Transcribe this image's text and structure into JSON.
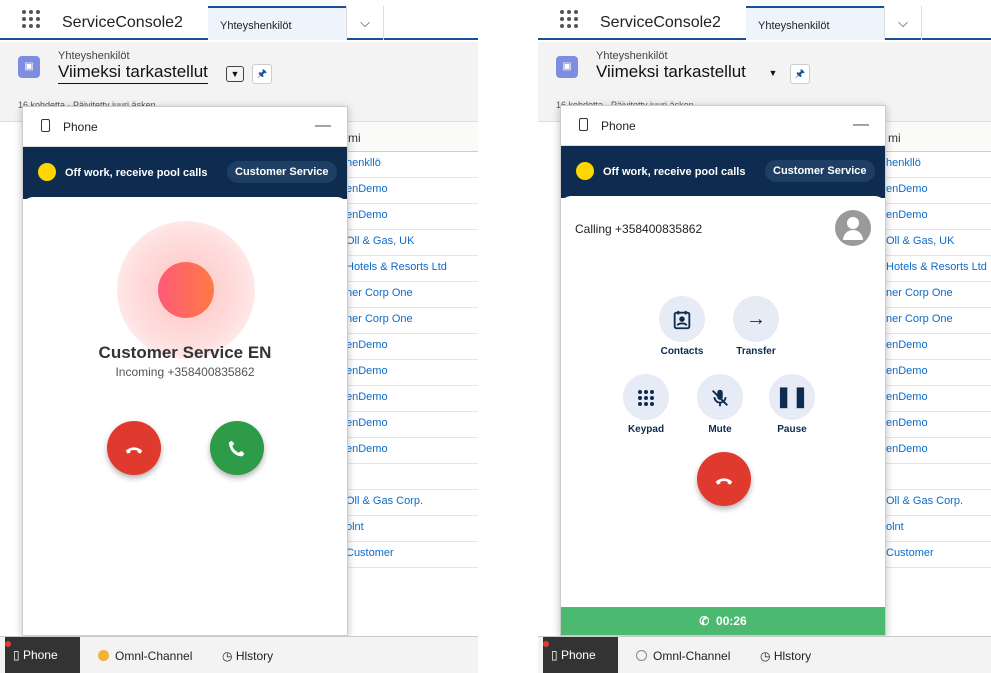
{
  "app": {
    "name": "ServiceConsole2",
    "tab": "Yhteyshenkilöt"
  },
  "listview": {
    "object_label": "Yhteyshenkilöt",
    "name": "Viimeksi tarkastellut",
    "count_text": "16 kohdetta · Päivitetty juuri äsken",
    "column": "mi"
  },
  "left_rows": [
    "henkllö",
    "enDemo",
    "enDemo",
    "Oll & Gas, UK",
    "Hotels & Resorts Ltd",
    "ner Corp One",
    "ner Corp One",
    "enDemo",
    "enDemo",
    "enDemo",
    "enDemo",
    "enDemo",
    "",
    "Oll & Gas Corp.",
    "olnt",
    "Customer"
  ],
  "right_rows": [
    "henkllö",
    "enDemo",
    "enDemo",
    "Oll & Gas, UK",
    "Hotels & Resorts Ltd",
    "ner Corp One",
    "ner Corp One",
    "enDemo",
    "enDemo",
    "enDemo",
    "enDemo",
    "enDemo",
    "",
    "Oll & Gas Corp.",
    "olnt",
    "Customer"
  ],
  "phone": {
    "title": "Phone",
    "status": "Off work, receive pool calls",
    "queue": "Customer Service",
    "incoming": {
      "name": "Customer Service EN",
      "number_text": "Incoming +358400835862"
    },
    "active": {
      "calling_text": "Calling +358400835862",
      "timer": "00:26",
      "actions": {
        "contacts": "Contacts",
        "transfer": "Transfer",
        "keypad": "Keypad",
        "mute": "Mute",
        "pause": "Pause"
      }
    }
  },
  "bottom": {
    "phone": "Phone",
    "omni": "Omnl-Channel",
    "history": "Hlstory"
  },
  "colors": {
    "accent": "#1b5297",
    "status_bg": "#0d2c4f",
    "decline": "#e03a2f",
    "accept": "#2e9b48",
    "presence": "#ffd600",
    "timer_bar": "#4cb970"
  }
}
